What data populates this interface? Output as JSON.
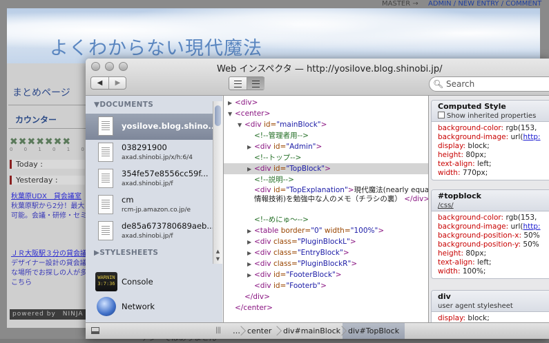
{
  "blog": {
    "nav_master": "MASTER →",
    "nav_links": "ADMIN / NEW ENTRY / COMMENT",
    "title": "よくわからない現代魔法",
    "matome": "まとめページ",
    "counter": "カウンター",
    "stars": "✖✖✖✖✖✖✖",
    "digits": "0 0 1 0 1 0 0",
    "today": "Today :",
    "yesterday": "Yesterday :",
    "ad1_title": "秋葉原UDX　貸会議室",
    "ad1_line1": "秋葉原駅から2分！最大",
    "ad1_line2": "可能。会議・研修・セミ",
    "ad2_title": "ＪＲ大阪駅３分の貸会議",
    "ad2_line1": "デザイナー設計の貸会議",
    "ad2_line2": "な場所でお探しの人が多",
    "ad2_line3": "こちら",
    "powered": "powered by　NINJA",
    "bottom_text": "アジーではありません"
  },
  "window": {
    "title": "Web インスペクタ — http://yosilove.blog.shinobi.jp/",
    "back_label": "◀",
    "forward_label": "▶",
    "search_placeholder": "Search",
    "search_icon": "🔍︎"
  },
  "sidebar": {
    "documents_header": "▼DOCUMENTS",
    "stylesheets_header": "▶STYLESHEETS",
    "documents": [
      {
        "name": "yosilove.blog.shino...",
        "sub": ""
      },
      {
        "name": "038291900",
        "sub": "axad.shinobi.jp/x/h:6/4"
      },
      {
        "name": "354fe57e8556cc59f...",
        "sub": "axad.shinobi.jp/f"
      },
      {
        "name": "cm",
        "sub": "rcm-jp.amazon.co.jp/e"
      },
      {
        "name": "de85a673780689aeb...",
        "sub": "axad.shinobi.jp/f"
      }
    ],
    "tools": [
      {
        "label": "Console",
        "icon_text": "WARNIN\n3:7:36"
      },
      {
        "label": "Network"
      }
    ]
  },
  "dom": {
    "lines": [
      {
        "tw": "▶",
        "indent": 0,
        "tag_open": "<div>",
        "attrs": [],
        "after": ""
      },
      {
        "tw": "▼",
        "indent": 0,
        "tag_open": "<center>",
        "attrs": [],
        "after": ""
      },
      {
        "tw": "▼",
        "indent": 1,
        "tag": "div",
        "attrs": [
          {
            "n": "id",
            "v": "mainBlock"
          }
        ]
      },
      {
        "tw": "",
        "indent": 2,
        "comment": "<!--管理者用-->"
      },
      {
        "tw": "▶",
        "indent": 2,
        "tag": "div",
        "attrs": [
          {
            "n": "id",
            "v": "Admin"
          }
        ]
      },
      {
        "tw": "",
        "indent": 2,
        "comment": "<!--トップ-->"
      },
      {
        "tw": "▶",
        "indent": 2,
        "tag": "div",
        "attrs": [
          {
            "n": "id",
            "v": "TopBlock"
          }
        ],
        "selected": true
      },
      {
        "tw": "",
        "indent": 2,
        "comment": "<!--説明-->"
      }
    ],
    "explanation": {
      "tag": "div",
      "attr_name": "id",
      "attr_value": "TopExplanation",
      "text": "現代魔法(nearly equal 情報技術)を勉強中な人のメモ（チラシの裏）",
      "close": "</div>"
    },
    "lines2": [
      {
        "tw": "",
        "indent": 2,
        "comment": "<!--めにゅ〜-->"
      },
      {
        "tw": "▶",
        "indent": 2,
        "tag": "table",
        "attrs": [
          {
            "n": "border",
            "v": "0"
          },
          {
            "n": "width",
            "v": "100%"
          }
        ]
      },
      {
        "tw": "▶",
        "indent": 2,
        "tag": "div",
        "attrs": [
          {
            "n": "class",
            "v": "PluginBlockL"
          }
        ]
      },
      {
        "tw": "▶",
        "indent": 2,
        "tag": "div",
        "attrs": [
          {
            "n": "class",
            "v": "EntryBlock"
          }
        ]
      },
      {
        "tw": "▶",
        "indent": 2,
        "tag": "div",
        "attrs": [
          {
            "n": "class",
            "v": "PluginBlockR"
          }
        ]
      },
      {
        "tw": "▶",
        "indent": 2,
        "tag": "div",
        "attrs": [
          {
            "n": "id",
            "v": "FooterBlock"
          }
        ]
      },
      {
        "tw": "",
        "indent": 2,
        "tag": "div",
        "attrs": [
          {
            "n": "id",
            "v": "Footerb"
          }
        ]
      },
      {
        "tw": "",
        "indent": 1,
        "close": "</div>"
      },
      {
        "tw": "",
        "indent": 0,
        "close": "</center>"
      }
    ]
  },
  "styles": {
    "computed": {
      "title": "Computed Style",
      "checkbox_label": "Show inherited properties",
      "props": [
        {
          "n": "background-color",
          "v": "rgb(153,"
        },
        {
          "n": "background-image",
          "v": "url(",
          "link": "http:"
        },
        {
          "n": "display",
          "v": "block;"
        },
        {
          "n": "height",
          "v": "80px;"
        },
        {
          "n": "text-align",
          "v": "left;"
        },
        {
          "n": "width",
          "v": "770px;"
        }
      ]
    },
    "topblock": {
      "title": "#topblock",
      "source": "/css/",
      "props": [
        {
          "n": "background-color",
          "v": "rgb(153,"
        },
        {
          "n": "background-image",
          "v": "url(",
          "link": "http:"
        },
        {
          "n": "background-position-x",
          "v": "50%"
        },
        {
          "n": "background-position-y",
          "v": "50%"
        },
        {
          "n": "height",
          "v": "80px;"
        },
        {
          "n": "text-align",
          "v": "left;"
        },
        {
          "n": "width",
          "v": "100%;"
        }
      ]
    },
    "ua": {
      "title": "div",
      "subtitle": "user agent stylesheet",
      "props": [
        {
          "n": "display",
          "v": "block;"
        }
      ]
    }
  },
  "statusbar": {
    "grip": "|||",
    "crumbs": [
      "…",
      "center",
      "div#mainBlock",
      "div#TopBlock"
    ]
  }
}
